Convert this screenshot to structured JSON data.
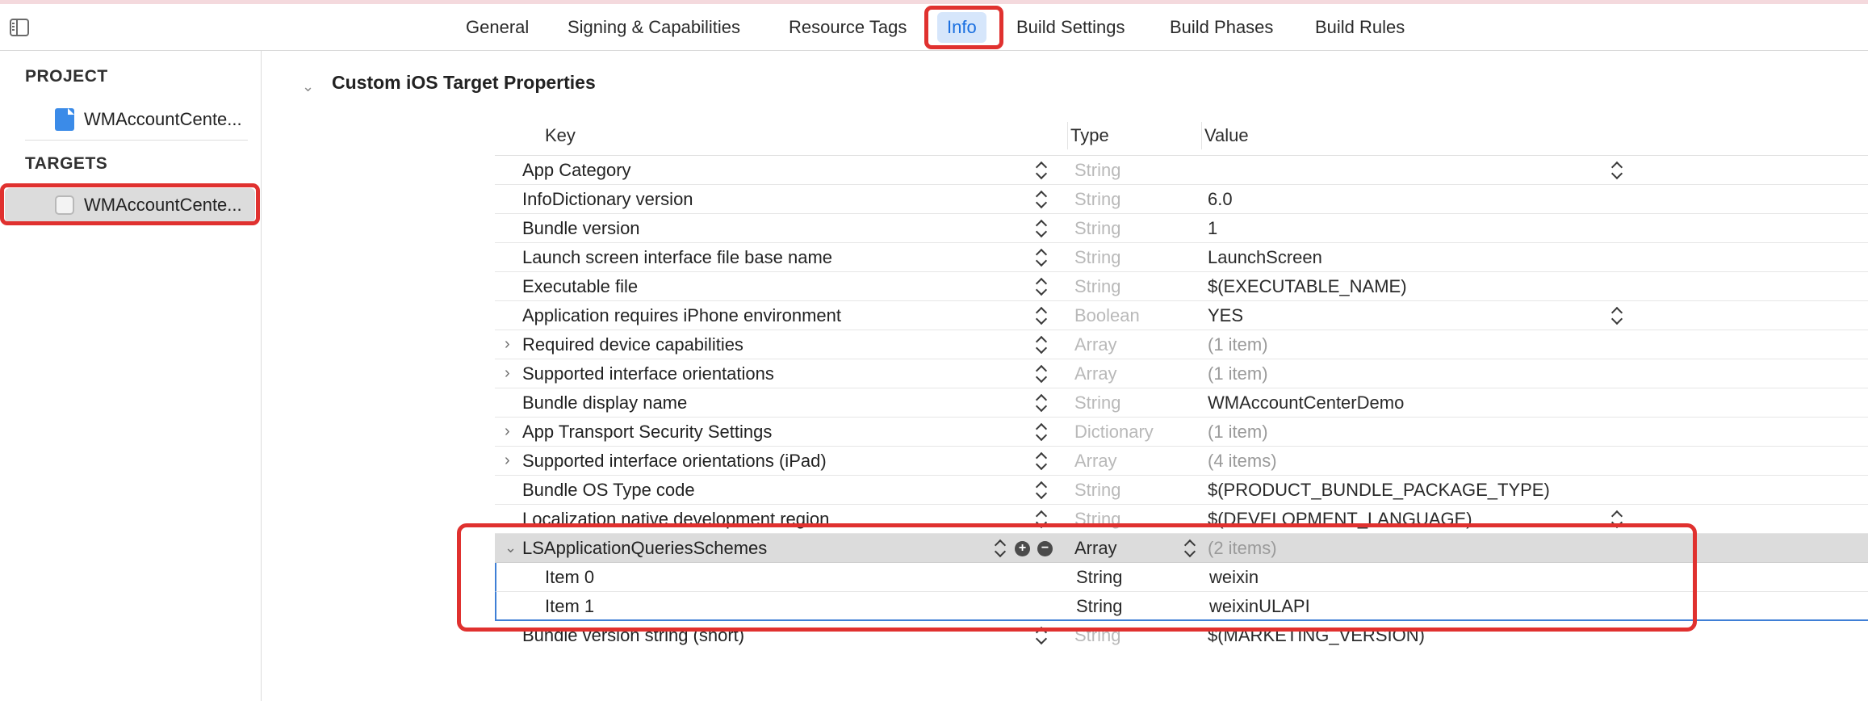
{
  "tabs": [
    {
      "label": "General",
      "active": false
    },
    {
      "label": "Signing & Capabilities",
      "active": false
    },
    {
      "label": "Resource Tags",
      "active": false
    },
    {
      "label": "Info",
      "active": true
    },
    {
      "label": "Build Settings",
      "active": false
    },
    {
      "label": "Build Phases",
      "active": false
    },
    {
      "label": "Build Rules",
      "active": false
    }
  ],
  "sidebar": {
    "project_header": "PROJECT",
    "project_item": "WMAccountCente...",
    "targets_header": "TARGETS",
    "target_item": "WMAccountCente..."
  },
  "main": {
    "section_title": "Custom iOS Target Properties",
    "columns": {
      "key": "Key",
      "type": "Type",
      "value": "Value"
    },
    "rows": [
      {
        "key": "App Category",
        "type": "String",
        "value": ""
      },
      {
        "key": "InfoDictionary version",
        "type": "String",
        "value": "6.0"
      },
      {
        "key": "Bundle version",
        "type": "String",
        "value": "1"
      },
      {
        "key": "Launch screen interface file base name",
        "type": "String",
        "value": "LaunchScreen"
      },
      {
        "key": "Executable file",
        "type": "String",
        "value": "$(EXECUTABLE_NAME)"
      },
      {
        "key": "Application requires iPhone environment",
        "type": "Boolean",
        "value": "YES"
      },
      {
        "key": "Required device capabilities",
        "type": "Array",
        "value": "(1 item)"
      },
      {
        "key": "Supported interface orientations",
        "type": "Array",
        "value": "(1 item)"
      },
      {
        "key": "Bundle display name",
        "type": "String",
        "value": "WMAccountCenterDemo"
      },
      {
        "key": "App Transport Security Settings",
        "type": "Dictionary",
        "value": "(1 item)"
      },
      {
        "key": "Supported interface orientations (iPad)",
        "type": "Array",
        "value": "(4 items)"
      },
      {
        "key": "Bundle OS Type code",
        "type": "String",
        "value": "$(PRODUCT_BUNDLE_PACKAGE_TYPE)"
      },
      {
        "key": "Localization native development region",
        "type": "String",
        "value": "$(DEVELOPMENT_LANGUAGE)"
      },
      {
        "key": "LSApplicationQueriesSchemes",
        "type": "Array",
        "value": "(2 items)"
      },
      {
        "key": "Item 0",
        "type": "String",
        "value": "weixin"
      },
      {
        "key": "Item 1",
        "type": "String",
        "value": "weixinULAPI"
      },
      {
        "key": "Bundle version string (short)",
        "type": "String",
        "value": "$(MARKETING_VERSION)"
      }
    ]
  },
  "colors": {
    "highlight_red": "#e0312f",
    "accent_blue": "#1a6fe0",
    "selection_gray": "#dcdcdc"
  },
  "icons": [
    "sidebar-toggle-icon",
    "project-file-icon",
    "target-app-icon",
    "chevron-right-icon",
    "chevron-down-icon",
    "stepper-icon",
    "add-circle-icon",
    "remove-circle-icon"
  ]
}
